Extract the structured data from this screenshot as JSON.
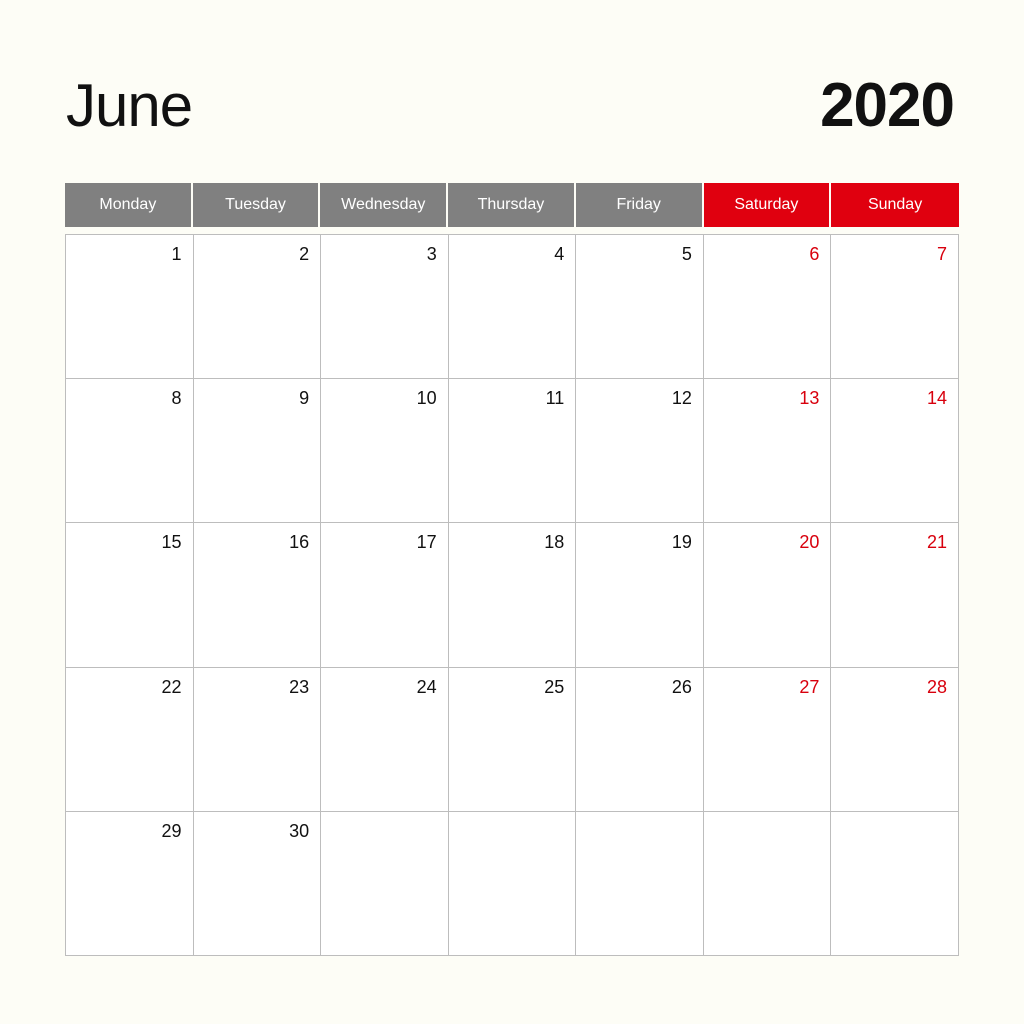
{
  "calendar": {
    "month": "June",
    "year": "2020",
    "weekdays": [
      {
        "label": "Monday",
        "weekend": false
      },
      {
        "label": "Tuesday",
        "weekend": false
      },
      {
        "label": "Wednesday",
        "weekend": false
      },
      {
        "label": "Thursday",
        "weekend": false
      },
      {
        "label": "Friday",
        "weekend": false
      },
      {
        "label": "Saturday",
        "weekend": true
      },
      {
        "label": "Sunday",
        "weekend": true
      }
    ],
    "weeks": [
      [
        "1",
        "2",
        "3",
        "4",
        "5",
        "6",
        "7"
      ],
      [
        "8",
        "9",
        "10",
        "11",
        "12",
        "13",
        "14"
      ],
      [
        "15",
        "16",
        "17",
        "18",
        "19",
        "20",
        "21"
      ],
      [
        "22",
        "23",
        "24",
        "25",
        "26",
        "27",
        "28"
      ],
      [
        "29",
        "30",
        "",
        "",
        "",
        "",
        ""
      ]
    ],
    "colors": {
      "header_weekday": "#808080",
      "header_weekend": "#e0000f",
      "weekend_number": "#d8000d",
      "grid_line": "#bdbdbd",
      "background": "#fdfdf6"
    }
  }
}
